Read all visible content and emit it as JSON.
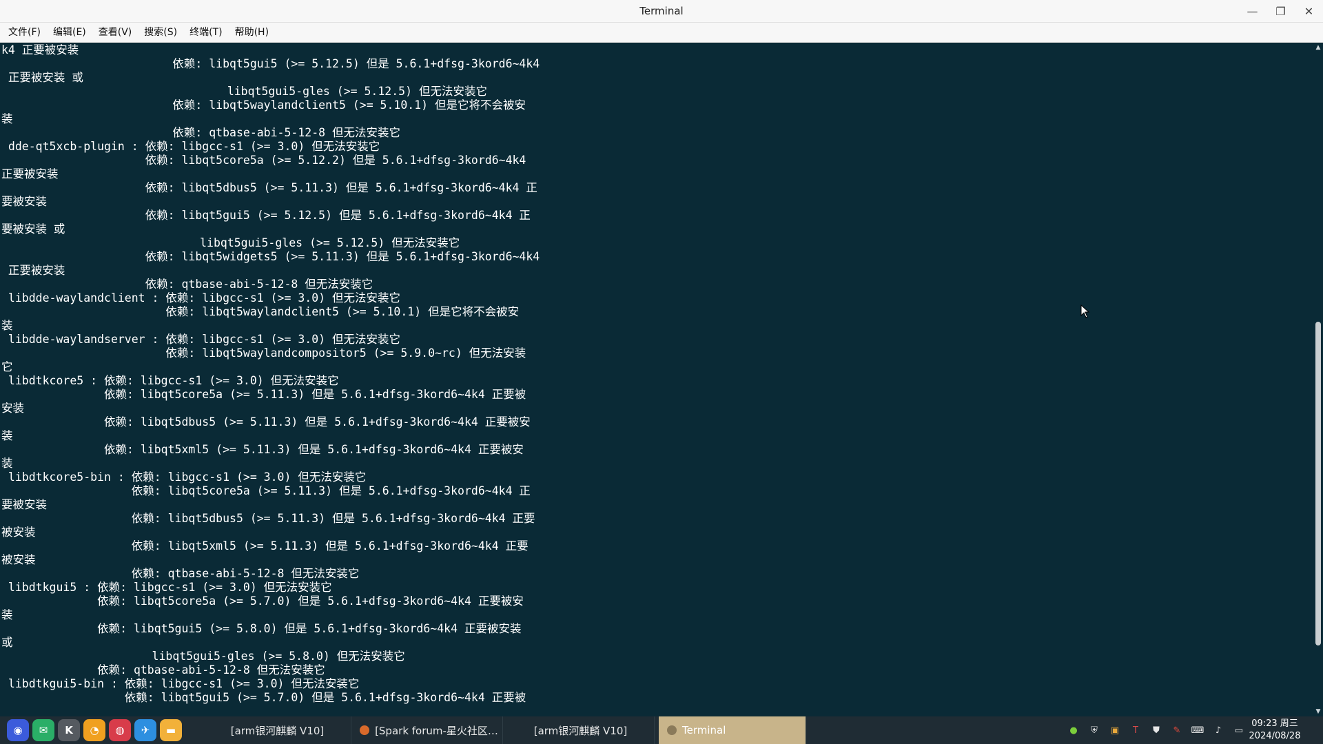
{
  "window": {
    "title": "Terminal",
    "controls": {
      "minimize": "—",
      "restore": "❐",
      "close": "✕"
    }
  },
  "menu": [
    {
      "id": "file",
      "label": "文件(F)"
    },
    {
      "id": "edit",
      "label": "编辑(E)"
    },
    {
      "id": "view",
      "label": "查看(V)"
    },
    {
      "id": "search",
      "label": "搜索(S)"
    },
    {
      "id": "terminal",
      "label": "终端(T)"
    },
    {
      "id": "help",
      "label": "帮助(H)"
    }
  ],
  "terminal": {
    "lines": [
      "k4 正要被安装",
      "                         依赖: libqt5gui5 (>= 5.12.5) 但是 5.6.1+dfsg-3kord6~4k4",
      " 正要被安装 或",
      "                                 libqt5gui5-gles (>= 5.12.5) 但无法安装它",
      "                         依赖: libqt5waylandclient5 (>= 5.10.1) 但是它将不会被安",
      "装",
      "                         依赖: qtbase-abi-5-12-8 但无法安装它",
      " dde-qt5xcb-plugin : 依赖: libgcc-s1 (>= 3.0) 但无法安装它",
      "                     依赖: libqt5core5a (>= 5.12.2) 但是 5.6.1+dfsg-3kord6~4k4",
      "正要被安装",
      "                     依赖: libqt5dbus5 (>= 5.11.3) 但是 5.6.1+dfsg-3kord6~4k4 正",
      "要被安装",
      "                     依赖: libqt5gui5 (>= 5.12.5) 但是 5.6.1+dfsg-3kord6~4k4 正",
      "要被安装 或",
      "                             libqt5gui5-gles (>= 5.12.5) 但无法安装它",
      "                     依赖: libqt5widgets5 (>= 5.11.3) 但是 5.6.1+dfsg-3kord6~4k4",
      " 正要被安装",
      "                     依赖: qtbase-abi-5-12-8 但无法安装它",
      " libdde-waylandclient : 依赖: libgcc-s1 (>= 3.0) 但无法安装它",
      "                        依赖: libqt5waylandclient5 (>= 5.10.1) 但是它将不会被安",
      "装",
      " libdde-waylandserver : 依赖: libgcc-s1 (>= 3.0) 但无法安装它",
      "                        依赖: libqt5waylandcompositor5 (>= 5.9.0~rc) 但无法安装",
      "它",
      " libdtkcore5 : 依赖: libgcc-s1 (>= 3.0) 但无法安装它",
      "               依赖: libqt5core5a (>= 5.11.3) 但是 5.6.1+dfsg-3kord6~4k4 正要被",
      "安装",
      "               依赖: libqt5dbus5 (>= 5.11.3) 但是 5.6.1+dfsg-3kord6~4k4 正要被安",
      "装",
      "               依赖: libqt5xml5 (>= 5.11.3) 但是 5.6.1+dfsg-3kord6~4k4 正要被安",
      "装",
      " libdtkcore5-bin : 依赖: libgcc-s1 (>= 3.0) 但无法安装它",
      "                   依赖: libqt5core5a (>= 5.11.3) 但是 5.6.1+dfsg-3kord6~4k4 正",
      "要被安装",
      "                   依赖: libqt5dbus5 (>= 5.11.3) 但是 5.6.1+dfsg-3kord6~4k4 正要",
      "被安装",
      "                   依赖: libqt5xml5 (>= 5.11.3) 但是 5.6.1+dfsg-3kord6~4k4 正要",
      "被安装",
      "                   依赖: qtbase-abi-5-12-8 但无法安装它",
      " libdtkgui5 : 依赖: libgcc-s1 (>= 3.0) 但无法安装它",
      "              依赖: libqt5core5a (>= 5.7.0) 但是 5.6.1+dfsg-3kord6~4k4 正要被安",
      "装",
      "              依赖: libqt5gui5 (>= 5.8.0) 但是 5.6.1+dfsg-3kord6~4k4 正要被安装",
      "或",
      "                      libqt5gui5-gles (>= 5.8.0) 但无法安装它",
      "              依赖: qtbase-abi-5-12-8 但无法安装它",
      " libdtkgui5-bin : 依赖: libgcc-s1 (>= 3.0) 但无法安装它",
      "                  依赖: libqt5gui5 (>= 5.7.0) 但是 5.6.1+dfsg-3kord6~4k4 正要被"
    ]
  },
  "taskbar": {
    "launcher": [
      {
        "id": "launcher",
        "icon": "launcher-icon",
        "glyph": "◉",
        "color": "#3b5bdb"
      },
      {
        "id": "wechat",
        "icon": "wechat-icon",
        "glyph": "✉",
        "color": "#2aae67"
      },
      {
        "id": "k-app",
        "icon": "k-app-icon",
        "glyph": "K",
        "color": "#555a60"
      },
      {
        "id": "browser",
        "icon": "browser-icon",
        "glyph": "◔",
        "color": "#f0a020"
      },
      {
        "id": "security",
        "icon": "security-icon",
        "glyph": "◍",
        "color": "#d83c4a"
      },
      {
        "id": "mail",
        "icon": "mail-icon",
        "glyph": "✈",
        "color": "#2d8fe0"
      },
      {
        "id": "files",
        "icon": "folder-icon",
        "glyph": "▬",
        "color": "#f2b13a"
      }
    ],
    "tasks": [
      {
        "label": "[arm银河麒麟 V10]",
        "icon_color": "",
        "active": false
      },
      {
        "label": "[Spark forum-星火社区…",
        "icon_color": "#d96a2b",
        "active": false
      },
      {
        "label": "[arm银河麒麟 V10]",
        "icon_color": "",
        "active": false
      },
      {
        "label": "Terminal",
        "icon_color": "#8a7a5a",
        "active": true
      }
    ],
    "tray": [
      {
        "icon": "network-icon",
        "glyph": "●",
        "color": "#7ccf3c"
      },
      {
        "icon": "shield-icon",
        "glyph": "⛨",
        "color": "#e6e6e6"
      },
      {
        "icon": "picture-icon",
        "glyph": "▣",
        "color": "#e7a83c"
      },
      {
        "icon": "text-tool-icon",
        "glyph": "T",
        "color": "#d84a4a"
      },
      {
        "icon": "security-tray-icon",
        "glyph": "⛊",
        "color": "#e6e6e6"
      },
      {
        "icon": "pen-icon",
        "glyph": "✎",
        "color": "#e24a3c"
      },
      {
        "icon": "keyboard-icon",
        "glyph": "⌨",
        "color": "#e6e6e6"
      },
      {
        "icon": "volume-icon",
        "glyph": "♪",
        "color": "#e6e6e6"
      },
      {
        "icon": "display-icon",
        "glyph": "▭",
        "color": "#e6e6e6"
      }
    ],
    "clock": {
      "time": "09:23 周三",
      "date": "2024/08/28"
    }
  }
}
